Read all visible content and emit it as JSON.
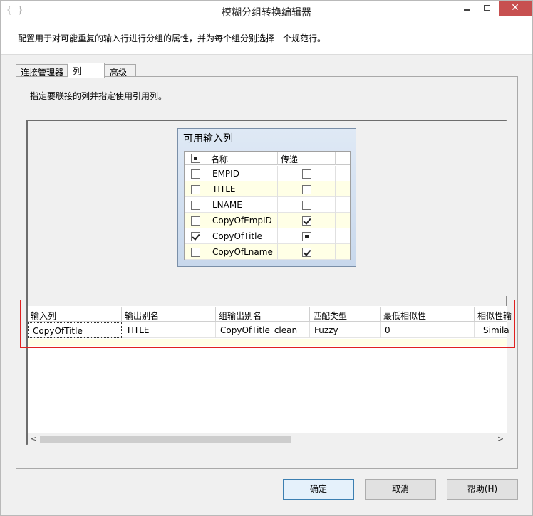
{
  "window": {
    "title": "模糊分组转换编辑器",
    "icon_text": "{ }",
    "controls": {
      "minimize": "minimize-icon",
      "maximize": "maximize-icon",
      "close": "✕"
    }
  },
  "description": "配置用于对可能重复的输入行进行分组的属性，并为每个组分别选择一个规范行。",
  "tabs": [
    {
      "label": "连接管理器"
    },
    {
      "label": "列",
      "selected": true
    },
    {
      "label": "高级"
    }
  ],
  "instruction": "指定要联接的列并指定使用引用列。",
  "available": {
    "title": "可用输入列",
    "headers": {
      "name": "名称",
      "passthrough": "传递"
    },
    "rows": [
      {
        "name": "EMPID",
        "selected": false,
        "passthrough": false
      },
      {
        "name": "TITLE",
        "selected": false,
        "passthrough": false
      },
      {
        "name": "LNAME",
        "selected": false,
        "passthrough": false
      },
      {
        "name": "CopyOfEmpID",
        "selected": false,
        "passthrough": true
      },
      {
        "name": "CopyOfTitle",
        "selected": true,
        "passthrough": "mixed"
      },
      {
        "name": "CopyOfLname",
        "selected": false,
        "passthrough": true
      }
    ]
  },
  "mapping": {
    "headers": [
      "输入列",
      "输出别名",
      "组输出别名",
      "匹配类型",
      "最低相似性",
      "相似性输"
    ],
    "rows": [
      [
        "CopyOfTitle",
        "TITLE",
        "CopyOfTitle_clean",
        "Fuzzy",
        "0",
        "_Simila"
      ]
    ]
  },
  "buttons": {
    "ok": "确定",
    "cancel": "取消",
    "help": "帮助(H)"
  },
  "colors": {
    "close_button": "#c75050",
    "highlight_border": "#e02020",
    "alt_row": "#ffffe6"
  }
}
